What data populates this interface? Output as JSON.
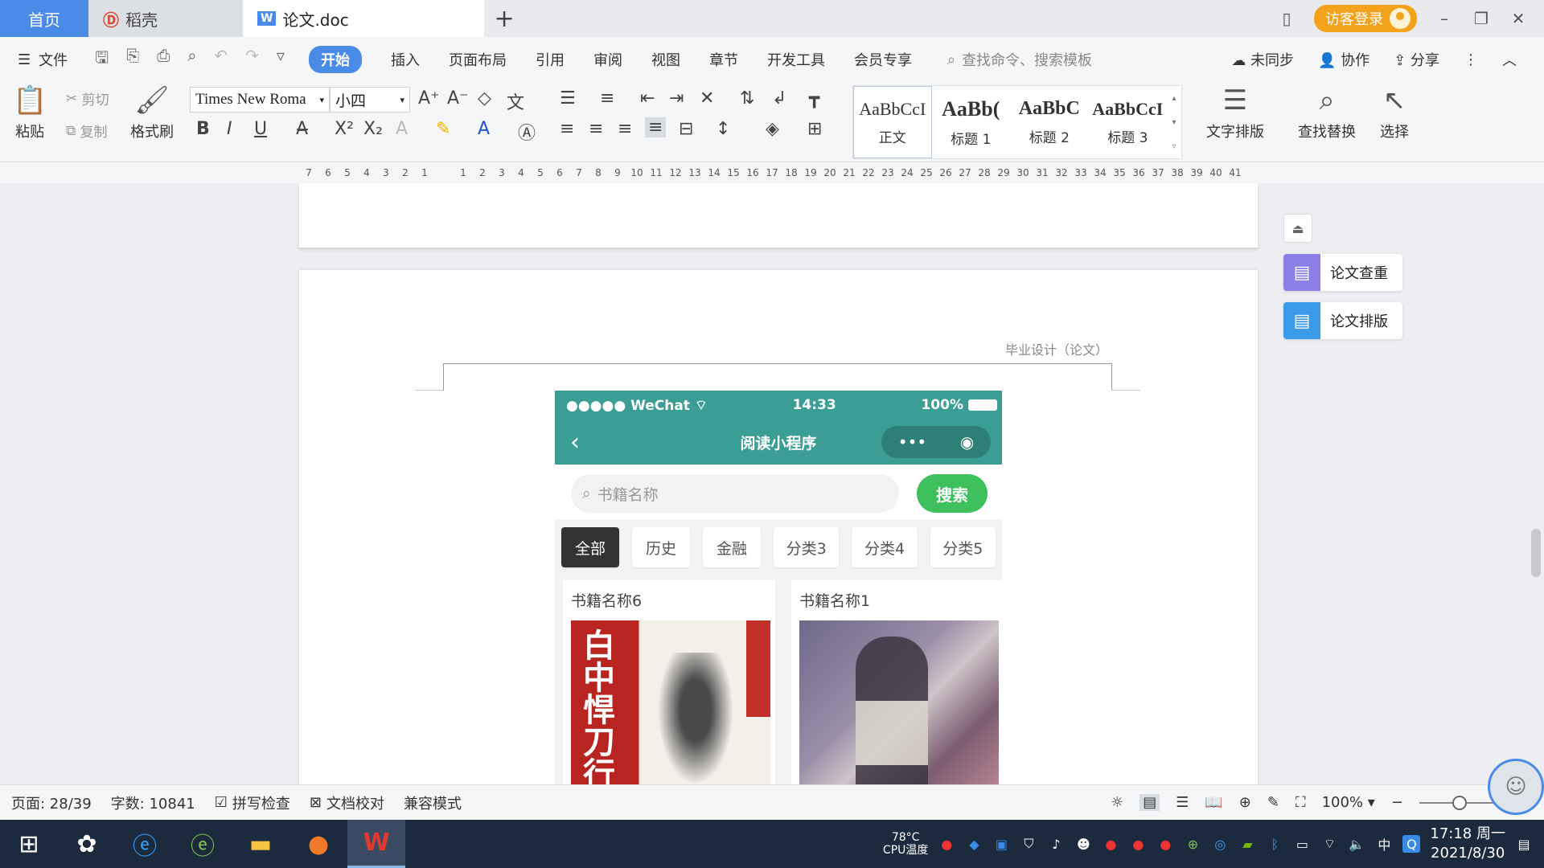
{
  "titlebar": {
    "tabs": [
      {
        "label": "首页"
      },
      {
        "label": "稻壳"
      },
      {
        "label": "论文.doc"
      }
    ],
    "login": "访客登录"
  },
  "menu": {
    "file": "文件",
    "items": [
      "开始",
      "插入",
      "页面布局",
      "引用",
      "审阅",
      "视图",
      "章节",
      "开发工具",
      "会员专享"
    ],
    "search_placeholder": "查找命令、搜索模板",
    "right": [
      "未同步",
      "协作",
      "分享"
    ]
  },
  "ribbon": {
    "paste": "粘贴",
    "cut": "剪切",
    "copy": "复制",
    "format_painter": "格式刷",
    "font_name": "Times New Roma",
    "font_size": "小四",
    "styles": [
      {
        "preview": "AaBbCcI",
        "label": "正文"
      },
      {
        "preview": "AaBb(",
        "label": "标题 1"
      },
      {
        "preview": "AaBbC",
        "label": "标题 2"
      },
      {
        "preview": "AaBbCcI",
        "label": "标题 3"
      }
    ],
    "text_layout": "文字排版",
    "find_replace": "查找替换",
    "select": "选择"
  },
  "ruler": {
    "ticks": [
      "7",
      "6",
      "5",
      "4",
      "3",
      "2",
      "1",
      "",
      "1",
      "2",
      "3",
      "4",
      "5",
      "6",
      "7",
      "8",
      "9",
      "10",
      "11",
      "12",
      "13",
      "14",
      "15",
      "16",
      "17",
      "18",
      "19",
      "20",
      "21",
      "22",
      "23",
      "24",
      "25",
      "26",
      "27",
      "28",
      "29",
      "30",
      "31",
      "32",
      "33",
      "34",
      "35",
      "36",
      "37",
      "38",
      "39",
      "40",
      "41"
    ]
  },
  "document": {
    "header_text": "毕业设计（论文）",
    "phone": {
      "carrier": "●●●●● WeChat",
      "time": "14:33",
      "battery": "100%",
      "title": "阅读小程序",
      "search_placeholder": "书籍名称",
      "search_button": "搜索",
      "categories": [
        "全部",
        "历史",
        "金融",
        "分类3",
        "分类4",
        "分类5"
      ],
      "books": [
        {
          "title": "书籍名称6",
          "cover_text": "白中悍刀行"
        },
        {
          "title": "书籍名称1"
        }
      ]
    }
  },
  "side_panel": {
    "check": "论文查重",
    "layout": "论文排版"
  },
  "statusbar": {
    "page": "页面: 28/39",
    "words": "字数: 10841",
    "spell": "拼写检查",
    "proof": "文档校对",
    "compat": "兼容模式",
    "zoom": "100%",
    "zoom_level": 0.5
  },
  "taskbar": {
    "temp": "78°C",
    "temp_label": "CPU温度",
    "ime": "中",
    "time": "17:18 周一",
    "date": "2021/8/30"
  },
  "colors": {
    "accent": "#4a8be8",
    "login": "#f3a21b",
    "phone_bar": "#3a9e95",
    "search_green": "#3ec15c"
  }
}
